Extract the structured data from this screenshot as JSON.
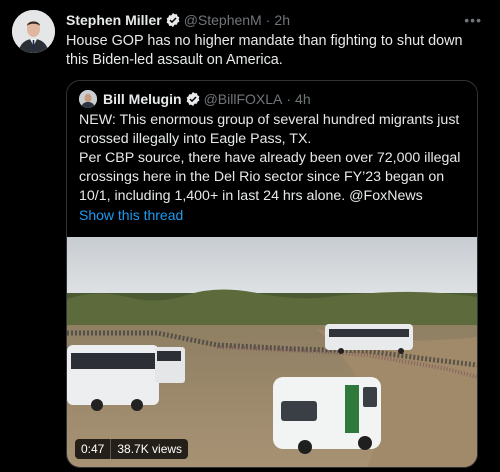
{
  "tweet": {
    "author_name": "Stephen Miller",
    "handle": "@StephenM",
    "time": "2h",
    "more_label": "•••",
    "text": "House GOP has no higher mandate than fighting to shut down this Biden-led assault on America."
  },
  "quoted": {
    "author_name": "Bill Melugin",
    "handle": "@BillFOXLA",
    "time": "4h",
    "text": "NEW: This enormous group of several hundred migrants just crossed illegally into Eagle Pass, TX.\nPer CBP source, there have already been over 72,000 illegal crossings here in the Del Rio sector since FY’23 began on 10/1, including 1,400+ in last 24 hrs alone. @FoxNews",
    "show_thread": "Show this thread",
    "video": {
      "duration": "0:47",
      "views": "38.7K views"
    }
  },
  "icons": {
    "verified": "verified-badge-icon",
    "more": "more-options-icon"
  },
  "colors": {
    "background": "#000000",
    "text": "#e7e9ea",
    "muted": "#71767b",
    "link": "#1d9bf0",
    "border": "#2f3336"
  }
}
